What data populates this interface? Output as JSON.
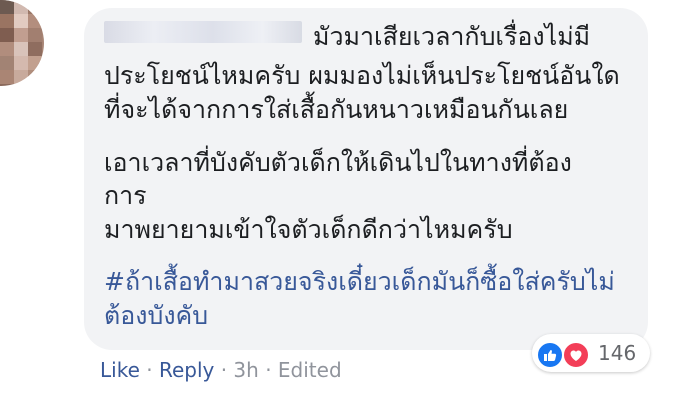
{
  "comment": {
    "author_blurred": "",
    "paragraphs": [
      {
        "lines": [
          "มัวมาเสียเวลากับเรื่องไม่มี",
          "ประโยชน์ไหมครับ ผมมองไม่เห็นประโยชน์อันใด",
          "ที่จะได้จากการใส่เสื้อกันหนาวเหมือนกันเลย"
        ]
      },
      {
        "lines": [
          "เอาเวลาที่บังคับตัวเด็กให้เดินไปในทางที่ต้อง",
          "การ",
          "มาพยายามเข้าใจตัวเด็กดีกว่าไหมครับ"
        ]
      }
    ],
    "hashtag": {
      "line1": "#ถ้าเสื้อทำมาสวยจริงเดี๋ยวเด็กมันก็ซื้อใส่ครับไม่",
      "line2": "ต้องบังคับ"
    }
  },
  "reactions": {
    "icons": [
      "like-icon",
      "love-icon"
    ],
    "count": "146",
    "colors": {
      "like": "#1877f2",
      "love": "#f33e58"
    }
  },
  "actions": {
    "like_label": "Like",
    "separator": "·",
    "reply_label": "Reply",
    "time": "3h",
    "edited_label": "Edited"
  },
  "colors": {
    "bubble": "#f2f3f5",
    "text": "#1c1e21",
    "link": "#385898",
    "meta": "#90949c"
  }
}
